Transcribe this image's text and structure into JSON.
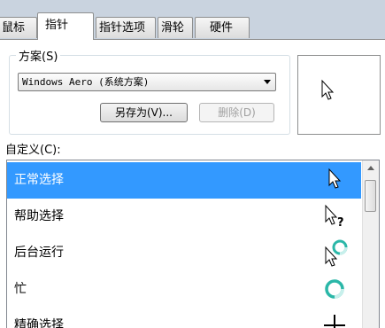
{
  "tabs": [
    {
      "label": "鼠标键"
    },
    {
      "label": "指针"
    },
    {
      "label": "指针选项"
    },
    {
      "label": "滑轮"
    },
    {
      "label": "硬件"
    }
  ],
  "scheme": {
    "group_label": "方案(S)",
    "selected_value": "Windows Aero (系统方案)",
    "save_as_label": "另存为(V)...",
    "delete_label": "删除(D)"
  },
  "custom": {
    "label": "自定义(C):",
    "items": [
      {
        "label": "正常选择",
        "icon": "arrow-pointer-icon"
      },
      {
        "label": "帮助选择",
        "icon": "help-select-icon"
      },
      {
        "label": "后台运行",
        "icon": "working-in-background-icon"
      },
      {
        "label": "忙",
        "icon": "busy-icon"
      },
      {
        "label": "精确选择",
        "icon": "precision-select-icon"
      }
    ],
    "selected_index": 0
  },
  "colors": {
    "selection": "#3399ff",
    "tab_strip": "#c9d3df"
  }
}
